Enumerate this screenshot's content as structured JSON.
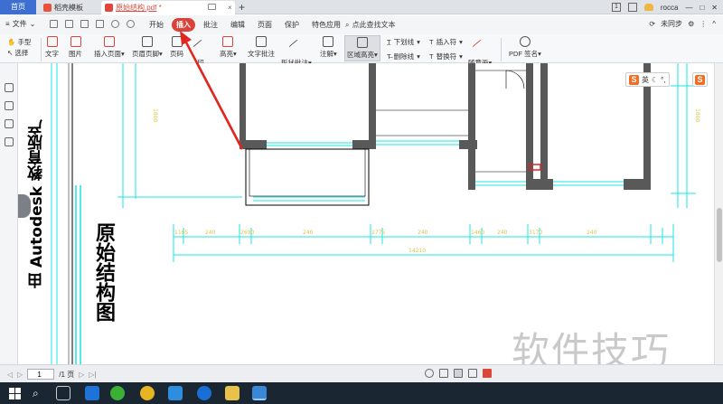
{
  "tabs": {
    "home": "首页",
    "template": "稻壳模板",
    "document": "原始结构.pdf",
    "document_modified": "*",
    "page_badge": "1",
    "user": "rocca"
  },
  "menu": {
    "file": "文件",
    "items": [
      "开始",
      "插入",
      "批注",
      "编辑",
      "页面",
      "保护",
      "特色应用"
    ],
    "active": "插入",
    "search": "点此查找文本",
    "sync": "未同步"
  },
  "ribbon": {
    "hand": "手型",
    "select": "选择",
    "text": "文字",
    "image": "图片",
    "insert_page": "插入页面",
    "header_footer": "页眉页脚",
    "page_number": "页码",
    "print": "印",
    "highlight": "高亮",
    "text_annotation": "文字批注",
    "shape_annotation": "形状批注",
    "note": "注解",
    "area_highlight": "区域高亮",
    "underline": "下划线",
    "strikethrough": "删除线",
    "insert_symbol": "插入符",
    "replace_symbol": "替换符",
    "freehand": "随意画",
    "pdf_sign": "PDF 签名"
  },
  "ime": {
    "lang": "英"
  },
  "drawing": {
    "vertical_text_1": "由 Autodesk 教育版产",
    "vertical_text_2": "原始结构图",
    "dimensions": [
      "1165",
      "240",
      "2690",
      "240",
      "2775",
      "240",
      "1460",
      "240",
      "3170",
      "240"
    ],
    "total": "14210",
    "side_dim_1": "1800",
    "side_dim_2": "1800"
  },
  "watermark": "软件技巧",
  "status": {
    "page": "1",
    "total_pages": "/1 页"
  }
}
